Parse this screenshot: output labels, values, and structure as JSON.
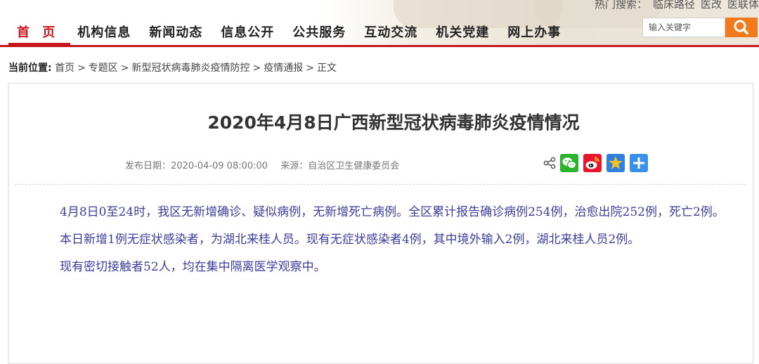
{
  "header": {
    "hot_search": {
      "label": "热门搜索：",
      "items": [
        "临床路径",
        "医改",
        "医联体"
      ]
    },
    "nav": [
      {
        "label": "首 页",
        "active": true
      },
      {
        "label": "机构信息"
      },
      {
        "label": "新闻动态"
      },
      {
        "label": "信息公开"
      },
      {
        "label": "公共服务"
      },
      {
        "label": "互动交流"
      },
      {
        "label": "机关党建"
      },
      {
        "label": "网上办事"
      }
    ],
    "search": {
      "placeholder": "输入关键字",
      "icon": "search-icon"
    }
  },
  "breadcrumb": {
    "label": "当前位置:",
    "items": [
      "首页",
      "专题区",
      "新型冠状病毒肺炎疫情防控",
      "疫情通报",
      "正文"
    ],
    "separator": ">"
  },
  "article": {
    "title": "2020年4月8日广西新型冠状病毒肺炎疫情情况",
    "publish_date": "发布日期：2020-04-09 08:00:00",
    "source": "来源：自治区卫生健康委员会",
    "share_icons": [
      "share-icon",
      "wechat-icon",
      "weibo-icon",
      "qzone-icon",
      "more-icon"
    ],
    "paragraphs": [
      "4月8日0至24时，我区无新增确诊、疑似病例，无新增死亡病例。全区累计报告确诊病例254例，治愈出院252例，死亡2例。",
      "本日新增1例无症状感染者，为湖北来桂人员。现有无症状感染者4例，其中境外输入2例，湖北来桂人员2例。",
      "现有密切接触者52人，均在集中隔离医学观察中。"
    ]
  },
  "colors": {
    "accent_red": "#c8161d",
    "search_orange": "#f07a1c",
    "content_text": "#3d3d9e",
    "wechat_green": "#2bb52b",
    "weibo_red": "#e6162d",
    "qzone_blue": "#2f7fe0",
    "more_blue": "#3a8fe8"
  }
}
